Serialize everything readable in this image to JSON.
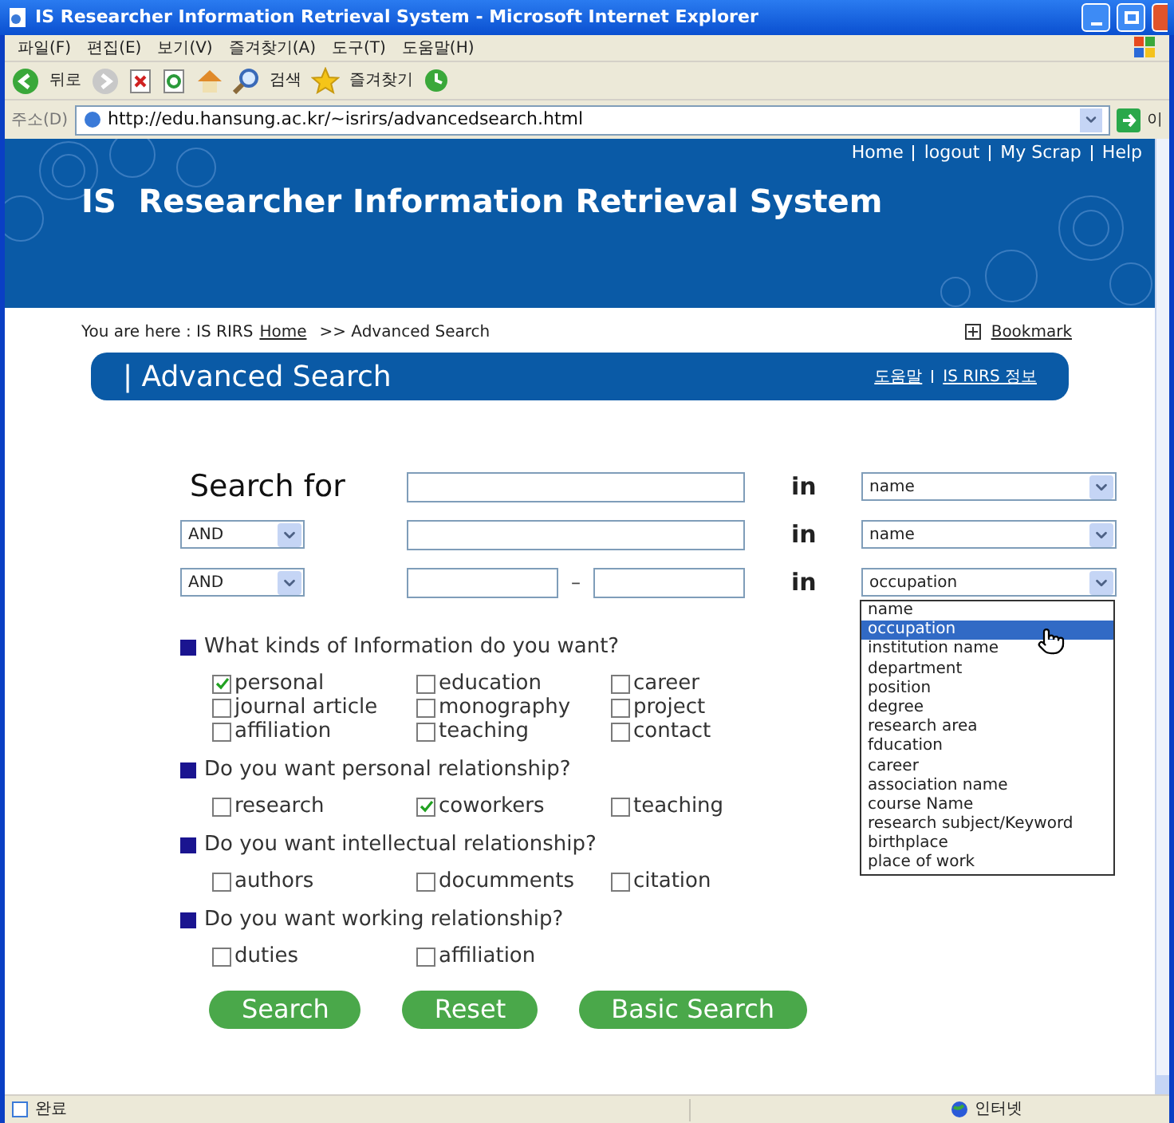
{
  "window": {
    "title": "IS Researcher Information Retrieval System  - Microsoft Internet Explorer"
  },
  "menu": [
    "파일(F)",
    "편집(E)",
    "보기(V)",
    "즐겨찾기(A)",
    "도구(T)",
    "도움말(H)"
  ],
  "toolbar": {
    "back": "뒤로",
    "search": "검색",
    "favorites": "즐겨찾기"
  },
  "address_bar": {
    "label": "주소(D)",
    "url": "http://edu.hansung.ac.kr/~isrirs/advancedsearch.html",
    "go": "이"
  },
  "top_links": [
    "Home",
    "logout",
    "My Scrap",
    "Help"
  ],
  "site_title": "IS  Researcher Information Retrieval System",
  "breadcrumb": {
    "prefix": "You are here : IS RIRS",
    "home": "Home",
    "current": ">> Advanced Search",
    "bookmark": "Bookmark"
  },
  "section_bar": {
    "title": "| Advanced Search",
    "links": [
      "도움말",
      "IS RIRS 정보"
    ]
  },
  "search_rows": [
    {
      "kind": "label",
      "label": "Search for",
      "in": "in",
      "field": "name"
    },
    {
      "kind": "operator",
      "operator": "AND",
      "in": "in",
      "field": "name"
    },
    {
      "kind": "range",
      "operator": "AND",
      "separator": "–",
      "in": "in",
      "field": "occupation"
    }
  ],
  "field_dropdown": {
    "options": [
      {
        "label": "name",
        "selected": false
      },
      {
        "label": "occupation",
        "selected": true
      },
      {
        "label": "institution name",
        "selected": false
      },
      {
        "label": "department",
        "selected": false
      },
      {
        "label": "position",
        "selected": false
      },
      {
        "label": "degree",
        "selected": false
      },
      {
        "label": "research area",
        "selected": false
      },
      {
        "label": "fducation",
        "selected": false
      },
      {
        "label": "career",
        "selected": false
      },
      {
        "label": "association name",
        "selected": false
      },
      {
        "label": "course Name",
        "selected": false
      },
      {
        "label": "research subject/Keyword",
        "selected": false
      },
      {
        "label": "birthplace",
        "selected": false
      },
      {
        "label": "place of work",
        "selected": false
      }
    ]
  },
  "sections": [
    {
      "question": "What kinds of Information do you want?",
      "options": [
        {
          "label": "personal",
          "checked": true
        },
        {
          "label": "education",
          "checked": false
        },
        {
          "label": "career",
          "checked": false
        },
        {
          "label": "journal article",
          "checked": false
        },
        {
          "label": "monography",
          "checked": false
        },
        {
          "label": "project",
          "checked": false
        },
        {
          "label": "affiliation",
          "checked": false
        },
        {
          "label": "teaching",
          "checked": false
        },
        {
          "label": "contact",
          "checked": false
        }
      ]
    },
    {
      "question": "Do you want personal relationship?",
      "options": [
        {
          "label": "research",
          "checked": false
        },
        {
          "label": "coworkers",
          "checked": true
        },
        {
          "label": "teaching",
          "checked": false
        }
      ]
    },
    {
      "question": "Do you want intellectual relationship?",
      "options": [
        {
          "label": "authors",
          "checked": false
        },
        {
          "label": "documments",
          "checked": false
        },
        {
          "label": "citation",
          "checked": false
        }
      ]
    },
    {
      "question": "Do you want working relationship?",
      "options": [
        {
          "label": "duties",
          "checked": false
        },
        {
          "label": "affiliation",
          "checked": false
        }
      ]
    }
  ],
  "buttons": [
    "Search",
    "Reset",
    "Basic Search"
  ],
  "status_bar": {
    "status": "완료",
    "zone": "인터넷"
  }
}
